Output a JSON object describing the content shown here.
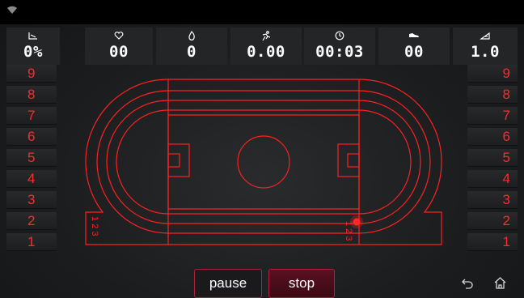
{
  "stats": {
    "incline": "0%",
    "heart_rate": "00",
    "calories": "0",
    "distance": "0.00",
    "time": "00:03",
    "steps": "00",
    "speed": "1.0"
  },
  "levels": {
    "left": [
      "9",
      "8",
      "7",
      "6",
      "5",
      "4",
      "3",
      "2",
      "1"
    ],
    "right": [
      "9",
      "8",
      "7",
      "6",
      "5",
      "4",
      "3",
      "2",
      "1"
    ]
  },
  "track": {
    "lane_labels_left": "1 2 3",
    "lane_labels_right": "1 2 3",
    "progress": 0.0
  },
  "buttons": {
    "pause": "pause",
    "stop": "stop"
  },
  "colors": {
    "accent": "#ff2020",
    "panel": "#242527",
    "button_border": "#b01e3a"
  },
  "icons": {
    "wifi": "wifi-icon",
    "incline": "incline-icon",
    "heart_rate": "heart-icon",
    "calories": "flame-icon",
    "distance": "runner-icon",
    "time": "clock-icon",
    "steps": "shoe-icon",
    "speed": "speed-icon",
    "back": "back-icon",
    "home": "home-icon"
  }
}
